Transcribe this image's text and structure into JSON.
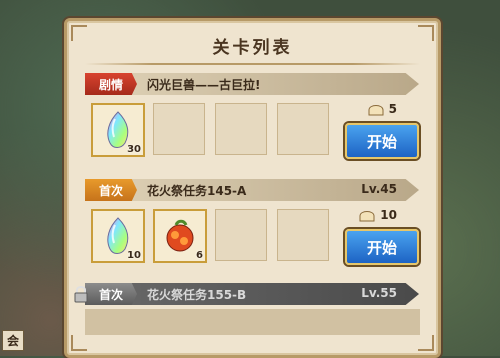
{
  "window": {
    "title": "关卡列表"
  },
  "map": {
    "corner_label": "会"
  },
  "stages": [
    {
      "tag": "剧情",
      "name": "闪光巨兽——古巨拉!",
      "level": "",
      "stamina": "5",
      "start_label": "开始",
      "rewards": [
        {
          "icon": "rainbow-crystal-icon",
          "count": "30"
        }
      ]
    },
    {
      "tag": "首次",
      "name": "花火祭任务145-A",
      "level": "Lv.45",
      "stamina": "10",
      "start_label": "开始",
      "rewards": [
        {
          "icon": "rainbow-crystal-icon",
          "count": "10"
        },
        {
          "icon": "fire-fruit-icon",
          "count": "6"
        }
      ]
    },
    {
      "tag": "首次",
      "name": "花火祭任务155-B",
      "level": "Lv.55",
      "locked": true
    }
  ],
  "colors": {
    "story_tag": "#c9392a",
    "first_tag": "#e08a25",
    "start_button": "#2b7fe0"
  }
}
